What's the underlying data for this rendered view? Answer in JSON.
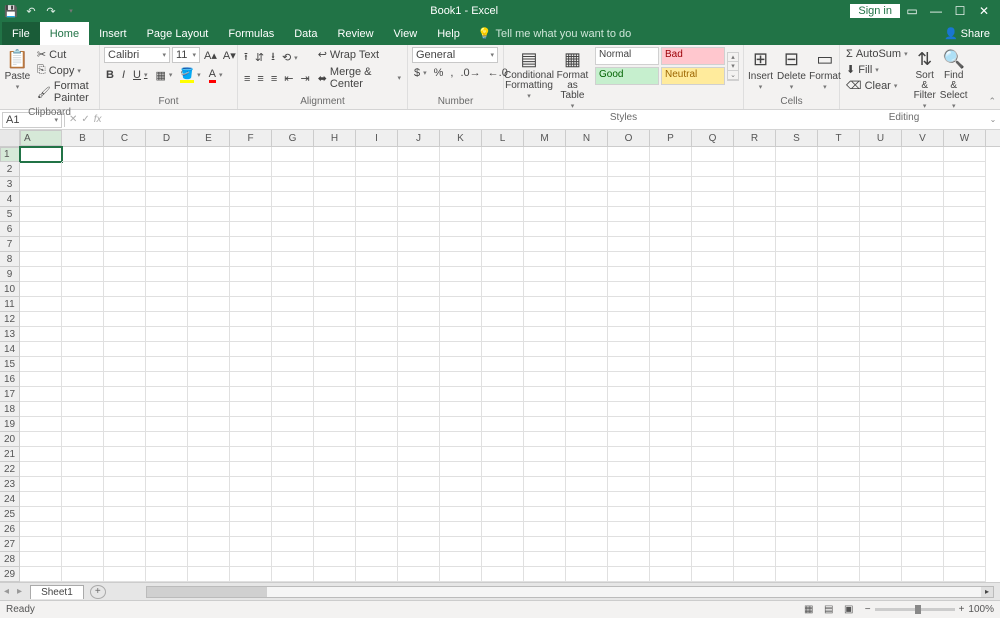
{
  "title": "Book1 - Excel",
  "signin": "Sign in",
  "tabs": [
    "File",
    "Home",
    "Insert",
    "Page Layout",
    "Formulas",
    "Data",
    "Review",
    "View",
    "Help"
  ],
  "active_tab": "Home",
  "tellme": "Tell me what you want to do",
  "share": "Share",
  "clipboard": {
    "label": "Clipboard",
    "paste": "Paste",
    "cut": "Cut",
    "copy": "Copy",
    "painter": "Format Painter"
  },
  "font": {
    "label": "Font",
    "name": "Calibri",
    "size": "11"
  },
  "alignment": {
    "label": "Alignment",
    "wrap": "Wrap Text",
    "merge": "Merge & Center"
  },
  "number": {
    "label": "Number",
    "format": "General"
  },
  "styles": {
    "label": "Styles",
    "cond": "Conditional Formatting",
    "table": "Format as Table",
    "normal": "Normal",
    "bad": "Bad",
    "good": "Good",
    "neutral": "Neutral"
  },
  "cells": {
    "label": "Cells",
    "insert": "Insert",
    "delete": "Delete",
    "format": "Format"
  },
  "editing": {
    "label": "Editing",
    "sum": "AutoSum",
    "fill": "Fill",
    "clear": "Clear",
    "sort": "Sort & Filter",
    "find": "Find & Select"
  },
  "namebox": "A1",
  "columns": [
    "A",
    "B",
    "C",
    "D",
    "E",
    "F",
    "G",
    "H",
    "I",
    "J",
    "K",
    "L",
    "M",
    "N",
    "O",
    "P",
    "Q",
    "R",
    "S",
    "T",
    "U",
    "V",
    "W"
  ],
  "visible_rows": 29,
  "active_cell": "A1",
  "sheet": "Sheet1",
  "status": "Ready",
  "zoom": "100%"
}
